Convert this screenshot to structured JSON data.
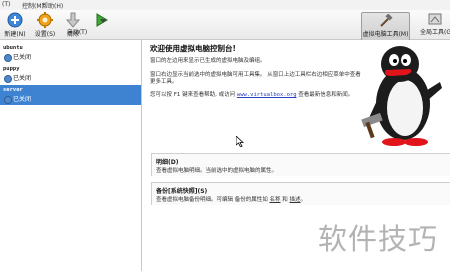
{
  "menubar": {
    "items": [
      "(T)",
      "控制(M)",
      "帮助(H)"
    ]
  },
  "toolbar": {
    "new_label": "新建(N)",
    "settings_label": "设置(S)",
    "discard_label": "清除",
    "start_label": "启动(T)",
    "machine_tools_label": "虚拟电脑工具(M)",
    "global_tools_label": "全局工具(G)"
  },
  "vms": [
    {
      "name": "ubuntu",
      "state": "已关闭",
      "selected": false
    },
    {
      "name": "puppy",
      "state": "已关闭",
      "selected": false
    },
    {
      "name": "server",
      "state": "已关闭",
      "selected": true
    }
  ],
  "welcome": {
    "title": "欢迎使用虚拟电脑控制台!",
    "p1": "窗口的左边用来显示已生成的虚拟电脑及编组。",
    "p2": "窗口右边显示当前选中的虚拟电脑可用工具集。 从窗口上边工具栏右边相应菜单中查看更多工具。",
    "p3_before": "您可以按 F1 键来查看帮助, 或访问",
    "p3_link": "www.virtualbox.org",
    "p3_after": "查看最新信息和新闻。"
  },
  "details_section": {
    "title": "明细(D)",
    "desc": "查看虚拟电脑明细。当前选中的虚拟电脑的属性。"
  },
  "snapshots_section": {
    "title": "备份[系统快照](S)",
    "desc_before": "查看虚拟电脑备份明细。可编辑 备份的属性如",
    "link1": "名称",
    "mid": "和",
    "link2": "描述",
    "desc_after": "。"
  },
  "watermark": "软件技巧",
  "colors": {
    "selection": "#3e83d2",
    "toolbar_bg": "#ececec",
    "link": "#2a3ec0"
  }
}
